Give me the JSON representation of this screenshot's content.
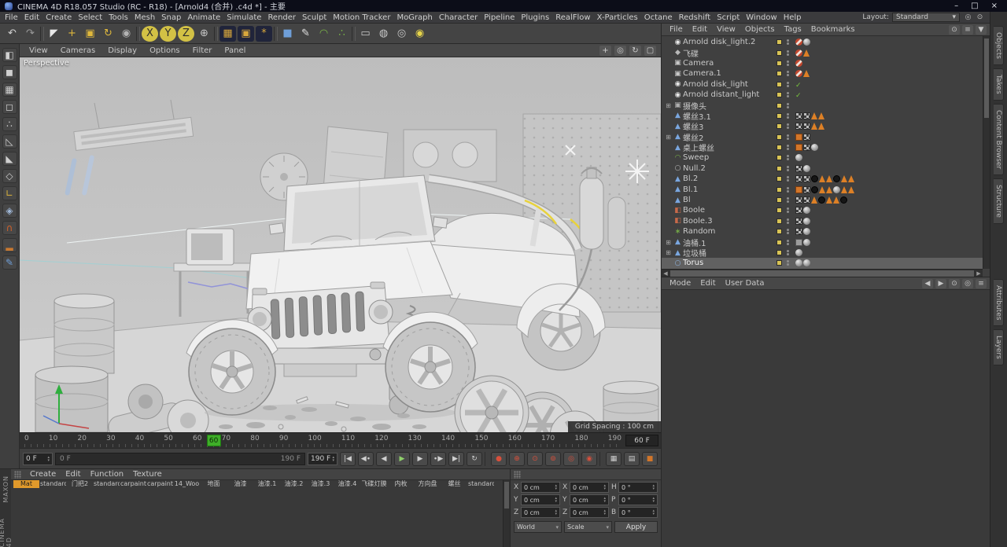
{
  "title_bar": {
    "title": "CINEMA 4D R18.057 Studio (RC - R18) - [Arnold4 (合并) .c4d *] - 主要",
    "controls": [
      {
        "dn": "minimize-button",
        "g": "–"
      },
      {
        "dn": "maximize-button",
        "g": "□"
      },
      {
        "dn": "close-button",
        "g": "×"
      }
    ]
  },
  "menu_bar": {
    "items": [
      "File",
      "Edit",
      "Create",
      "Select",
      "Tools",
      "Mesh",
      "Snap",
      "Animate",
      "Simulate",
      "Render",
      "Sculpt",
      "Motion Tracker",
      "MoGraph",
      "Character",
      "Pipeline",
      "Plugins",
      "RealFlow",
      "X-Particles",
      "Octane",
      "Redshift",
      "Script",
      "Window",
      "Help"
    ],
    "layout_label": "Layout:",
    "layout_value": "Standard",
    "right_icons": [
      {
        "dn": "search-icon",
        "g": "◎"
      },
      {
        "dn": "pin-icon",
        "g": "⊙"
      }
    ]
  },
  "toolbar": {
    "icons": [
      {
        "dn": "undo-icon",
        "g": "↶",
        "c": "#d2d2d2"
      },
      {
        "dn": "redo-icon",
        "g": "↷",
        "c": "#9a9a9a"
      },
      {
        "dn": "toolbar-divider"
      },
      {
        "dn": "live-selection-icon",
        "g": "◤",
        "c": "#e8e8e8"
      },
      {
        "dn": "move-tool-icon",
        "g": "+",
        "c": "#dfb83c"
      },
      {
        "dn": "scale-tool-icon",
        "g": "▣",
        "c": "#dfb83c"
      },
      {
        "dn": "rotate-tool-icon",
        "g": "↻",
        "c": "#dfb83c"
      },
      {
        "dn": "last-tool-icon",
        "g": "◉",
        "c": "#b2b2b2"
      },
      {
        "dn": "toolbar-divider"
      },
      {
        "dn": "x-axis-lock-button",
        "g": "X",
        "c": "#2c2c2c",
        "bg": "#d2c145",
        "rad": "50%"
      },
      {
        "dn": "y-axis-lock-button",
        "g": "Y",
        "c": "#2c2c2c",
        "bg": "#d2c145",
        "rad": "50%"
      },
      {
        "dn": "z-axis-lock-button",
        "g": "Z",
        "c": "#2c2c2c",
        "bg": "#d2c145",
        "rad": "50%"
      },
      {
        "dn": "coordinate-system-icon",
        "g": "⊕",
        "c": "#c8c8c8"
      },
      {
        "dn": "toolbar-divider"
      },
      {
        "dn": "render-view-icon",
        "g": "▦",
        "c": "#d8a73c",
        "bg": "#20243a"
      },
      {
        "dn": "render-picture-viewer-icon",
        "g": "▣",
        "c": "#d8a73c",
        "bg": "#20243a"
      },
      {
        "dn": "render-settings-icon",
        "g": "*",
        "c": "#d8a73c",
        "bg": "#20243a"
      },
      {
        "dn": "toolbar-divider"
      },
      {
        "dn": "add-cube-icon",
        "g": "■",
        "c": "#6f9fd8"
      },
      {
        "dn": "spline-pen-icon",
        "g": "✎",
        "c": "#e0e0e0"
      },
      {
        "dn": "bend-deformer-icon",
        "g": "◠",
        "c": "#7ab648"
      },
      {
        "dn": "array-icon",
        "g": "∴",
        "c": "#7ab648"
      },
      {
        "dn": "toolbar-divider"
      },
      {
        "dn": "floor-icon",
        "g": "▭",
        "c": "#c8c8c8"
      },
      {
        "dn": "sky-icon",
        "g": "◍",
        "c": "#c8c8c8"
      },
      {
        "dn": "camera-icon",
        "g": "◎",
        "c": "#c8c8c8"
      },
      {
        "dn": "light-icon",
        "g": "◉",
        "c": "#e6d44a"
      }
    ]
  },
  "left_toolbar": {
    "icons": [
      {
        "dn": "make-editable-icon",
        "g": "◧",
        "c": "#cfcfcf"
      },
      {
        "dn": "model-mode-icon",
        "g": "◼",
        "c": "#cfcfcf"
      },
      {
        "dn": "texture-mode-icon",
        "g": "▦",
        "c": "#cfcfcf"
      },
      {
        "dn": "workplane-mode-icon",
        "g": "◻",
        "c": "#cfcfcf"
      },
      {
        "dn": "points-mode-icon",
        "g": "∴",
        "c": "#cfcfcf"
      },
      {
        "dn": "edges-mode-icon",
        "g": "◺",
        "c": "#cfcfcf"
      },
      {
        "dn": "polygons-mode-icon",
        "g": "◣",
        "c": "#cfcfcf"
      },
      {
        "dn": "tweak-mode-icon",
        "g": "◇",
        "c": "#cfcfcf"
      },
      {
        "dn": "enable-axis-icon",
        "g": "∟",
        "c": "#d8b23c"
      },
      {
        "dn": "lock-axis-icon",
        "g": "◈",
        "c": "#9fb8d8"
      },
      {
        "dn": "snap-magnet-icon",
        "g": "∩",
        "c": "#d2622a"
      },
      {
        "dn": "workplane-snap-icon",
        "g": "▂",
        "c": "#c87830"
      },
      {
        "dn": "paint-tool-icon",
        "g": "✎",
        "c": "#6f9fd8"
      }
    ]
  },
  "viewport": {
    "menus": [
      "View",
      "Cameras",
      "Display",
      "Options",
      "Filter",
      "Panel"
    ],
    "nav_icons": [
      {
        "dn": "pan-view-icon",
        "g": "+"
      },
      {
        "dn": "zoom-view-icon",
        "g": "◎"
      },
      {
        "dn": "rotate-view-icon",
        "g": "↻"
      },
      {
        "dn": "maximize-view-icon",
        "g": "▢"
      }
    ],
    "label": "Perspective",
    "grid_spacing": "Grid Spacing : 100 cm"
  },
  "timeline": {
    "ticks": [
      "0",
      "10",
      "20",
      "30",
      "40",
      "50",
      "60",
      "70",
      "80",
      "90",
      "100",
      "110",
      "120",
      "130",
      "140",
      "150",
      "160",
      "170",
      "180",
      "190"
    ],
    "marker_label": "60",
    "current": "60 F"
  },
  "transport": {
    "start_frame": "0 F",
    "range_min": "0 F",
    "range_max": "190 F",
    "end_frame": "190 F",
    "buttons": [
      {
        "dn": "goto-start-button",
        "g": "|◀"
      },
      {
        "dn": "prev-key-button",
        "g": "◀∙"
      },
      {
        "dn": "prev-frame-button",
        "g": "◀"
      },
      {
        "dn": "play-button",
        "g": "▶",
        "c": "#8fd06a"
      },
      {
        "dn": "next-frame-button",
        "g": "▶"
      },
      {
        "dn": "next-key-button",
        "g": "∙▶"
      },
      {
        "dn": "goto-end-button",
        "g": "▶|"
      },
      {
        "dn": "loop-button",
        "g": "↻"
      },
      {
        "dn": "transport-divider"
      },
      {
        "dn": "record-key-button",
        "g": "●",
        "c": "#d8503c"
      },
      {
        "dn": "record-position-button",
        "g": "⊕",
        "c": "#d8503c"
      },
      {
        "dn": "record-scale-button",
        "g": "⊙",
        "c": "#d8503c"
      },
      {
        "dn": "record-rotation-button",
        "g": "⊚",
        "c": "#d8503c"
      },
      {
        "dn": "record-param-button",
        "g": "◎",
        "c": "#d8503c"
      },
      {
        "dn": "autokey-button",
        "g": "◉",
        "c": "#d8503c"
      },
      {
        "dn": "transport-divider"
      },
      {
        "dn": "keyframe-selection-button",
        "g": "▦"
      },
      {
        "dn": "hud-button",
        "g": "▤"
      },
      {
        "dn": "record-active-button",
        "g": "■",
        "c": "#d2762a"
      }
    ]
  },
  "materials": {
    "brand_line1": "MAXON",
    "brand_line2": "CINEMA 4D",
    "menus": [
      "Create",
      "Edit",
      "Function",
      "Texture"
    ],
    "items": [
      {
        "name": "Mat",
        "color": "#ececec",
        "selected": true
      },
      {
        "name": "standard",
        "color": "#8f8f8f"
      },
      {
        "name": "门把2",
        "color": "#474747"
      },
      {
        "name": "standard",
        "color": "#3c3c3c"
      },
      {
        "name": "carpaint",
        "color": "#c29222"
      },
      {
        "name": "carpaint",
        "color": "#c29222"
      },
      {
        "name": "14_Woo",
        "color": "#7c4a26"
      },
      {
        "name": "地面",
        "color": "#5a5148"
      },
      {
        "name": "油漆",
        "color": "#b4a488"
      },
      {
        "name": "油漆.1",
        "color": "#3a3a3a"
      },
      {
        "name": "油漆.2",
        "color": "#8a8a8a"
      },
      {
        "name": "油漆.3",
        "color": "#b8b8b8"
      },
      {
        "name": "油漆.4",
        "color": "#c49a2e"
      },
      {
        "name": "飞碟灯膜",
        "color": "#343434"
      },
      {
        "name": "内枚",
        "color": "#222222"
      },
      {
        "name": "方向盘",
        "color": "#4e4e4e"
      },
      {
        "name": "螺丝",
        "color": "#c4c4c4"
      },
      {
        "name": "standard",
        "color": "#857428"
      },
      {
        "color": "#3e3e3e"
      },
      {
        "color": "#b23030"
      },
      {
        "color": "#e8e8e8"
      },
      {
        "color": "#2f5cc4"
      },
      {
        "color": "#3f7ae0"
      },
      {
        "color": "#62c435"
      },
      {
        "color": "#8a8a8a"
      },
      {
        "color": "#5a5a5a"
      },
      {
        "color": "#303030"
      },
      {
        "color": "#c0c0c0"
      },
      {
        "color": "#444444"
      },
      {
        "color": "#666666"
      }
    ]
  },
  "coords": {
    "rows": [
      {
        "l1": "X",
        "v1": "0 cm",
        "l2": "X",
        "v2": "0 cm",
        "l3": "H",
        "v3": "0 °"
      },
      {
        "l1": "Y",
        "v1": "0 cm",
        "l2": "Y",
        "v2": "0 cm",
        "l3": "P",
        "v3": "0 °"
      },
      {
        "l1": "Z",
        "v1": "0 cm",
        "l2": "Z",
        "v2": "0 cm",
        "l3": "B",
        "v3": "0 °"
      }
    ],
    "dd1": "World",
    "dd2": "Scale",
    "apply": "Apply"
  },
  "object_manager": {
    "menus": [
      "File",
      "Edit",
      "View",
      "Objects",
      "Tags",
      "Bookmarks"
    ],
    "layer_color": "#d9c455",
    "header_icons": [
      {
        "dn": "search-icon",
        "g": "⊙"
      },
      {
        "dn": "filter-icon",
        "g": "≡"
      },
      {
        "dn": "scroll-down-icon",
        "g": "▼"
      }
    ],
    "rows": [
      {
        "name": "Arnold disk_light.2",
        "g": "◉",
        "c": "#e8e8e8",
        "tags": [
          "no",
          "sphere"
        ]
      },
      {
        "name": "飞碟",
        "g": "◆",
        "c": "#b8b8b8",
        "tags": [
          "no",
          "tri"
        ]
      },
      {
        "name": "Camera",
        "g": "▣",
        "c": "#c8c8c8",
        "tags": [
          "no"
        ]
      },
      {
        "name": "Camera.1",
        "g": "▣",
        "c": "#c8c8c8",
        "tags": [
          "no",
          "tri"
        ]
      },
      {
        "name": "Arnold disk_light",
        "g": "◉",
        "c": "#e8e8e8",
        "tags": [
          "check"
        ]
      },
      {
        "name": "Arnold distant_light",
        "g": "◉",
        "c": "#e8e8e8",
        "tags": [
          "check"
        ]
      },
      {
        "name": "摄像头",
        "g": "▣",
        "c": "#b0b0b0",
        "exp": "⊞",
        "tags": []
      },
      {
        "name": "螺丝3.1",
        "g": "▲",
        "c": "#7aa7e0",
        "tags": [
          "checker",
          "checker",
          "tri",
          "tri"
        ]
      },
      {
        "name": "螺丝3",
        "g": "▲",
        "c": "#7aa7e0",
        "tags": [
          "checker",
          "checker",
          "tri",
          "tri"
        ]
      },
      {
        "name": "螺丝2",
        "g": "▲",
        "c": "#7aa7e0",
        "exp": "⊞",
        "tags": [
          "orsq",
          "checker"
        ]
      },
      {
        "name": "桌上螺丝",
        "g": "▲",
        "c": "#7aa7e0",
        "tags": [
          "orsq",
          "checker",
          "sphere"
        ]
      },
      {
        "name": "Sweep",
        "g": "◠",
        "c": "#7ab648",
        "tags": [
          "sphere"
        ]
      },
      {
        "name": "Null.2",
        "g": "○",
        "c": "#b8b8b8",
        "tags": [
          "checker",
          "sphere"
        ]
      },
      {
        "name": "Bl.2",
        "g": "▲",
        "c": "#7aa7e0",
        "tags": [
          "checker",
          "checker",
          "dotk",
          "tri",
          "tri",
          "dotk",
          "tri",
          "tri"
        ]
      },
      {
        "name": "Bl.1",
        "g": "▲",
        "c": "#7aa7e0",
        "tags": [
          "orsq",
          "checker",
          "dotk",
          "tri",
          "tri",
          "sphere",
          "tri",
          "tri"
        ]
      },
      {
        "name": "Bl",
        "g": "▲",
        "c": "#7aa7e0",
        "tags": [
          "checker",
          "checker",
          "tri",
          "dotk",
          "tri",
          "tri",
          "dotk"
        ]
      },
      {
        "name": "Boole",
        "g": "◧",
        "c": "#c86a4a",
        "tags": [
          "checker",
          "sphere"
        ]
      },
      {
        "name": "Boole.3",
        "g": "◧",
        "c": "#c86a4a",
        "tags": [
          "checker",
          "sphere"
        ]
      },
      {
        "name": "Random",
        "g": "∗",
        "c": "#7ab648",
        "tags": [
          "checker",
          "sphere"
        ]
      },
      {
        "name": "油桶.1",
        "g": "▲",
        "c": "#7aa7e0",
        "exp": "⊞",
        "tags": [
          "graysq",
          "sphere"
        ]
      },
      {
        "name": "垃圾桶",
        "g": "▲",
        "c": "#7aa7e0",
        "exp": "⊞",
        "tags": [
          "sphere"
        ]
      },
      {
        "name": "Torus",
        "g": "○",
        "c": "#8fb4e0",
        "selected": true,
        "tags": [
          "sphere",
          "sphere"
        ]
      }
    ]
  },
  "attributes": {
    "menus": [
      "Mode",
      "Edit",
      "User Data"
    ],
    "header_icons": [
      {
        "dn": "history-back-icon",
        "g": "◀"
      },
      {
        "dn": "history-forward-icon",
        "g": "▶"
      },
      {
        "dn": "lock-icon",
        "g": "⊙"
      },
      {
        "dn": "search-icon",
        "g": "◎"
      },
      {
        "dn": "panel-menu-icon",
        "g": "≡"
      }
    ]
  },
  "right_tabs": {
    "top": [
      "Objects",
      "Takes",
      "Content Browser",
      "Structure"
    ],
    "bottom": [
      "Attributes",
      "Layers"
    ]
  }
}
